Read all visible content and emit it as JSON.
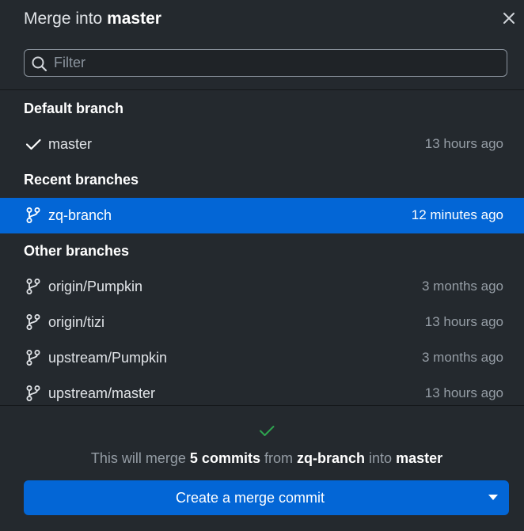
{
  "dialog": {
    "title_prefix": "Merge into",
    "title_target": "master"
  },
  "filter": {
    "placeholder": "Filter",
    "value": ""
  },
  "sections": {
    "default": "Default branch",
    "recent": "Recent branches",
    "other": "Other branches"
  },
  "branches": {
    "default": [
      {
        "name": "master",
        "time": "13 hours ago",
        "icon": "check-icon"
      }
    ],
    "recent": [
      {
        "name": "zq-branch",
        "time": "12 minutes ago",
        "icon": "git-branch-icon",
        "selected": true
      }
    ],
    "other": [
      {
        "name": "origin/Pumpkin",
        "time": "3 months ago",
        "icon": "git-branch-icon"
      },
      {
        "name": "origin/tizi",
        "time": "13 hours ago",
        "icon": "git-branch-icon"
      },
      {
        "name": "upstream/Pumpkin",
        "time": "3 months ago",
        "icon": "git-branch-icon"
      },
      {
        "name": "upstream/master",
        "time": "13 hours ago",
        "icon": "git-branch-icon"
      }
    ]
  },
  "merge_summary": {
    "prefix": "This will merge",
    "commits": "5 commits",
    "from_word": "from",
    "source": "zq-branch",
    "into_word": "into",
    "target": "master"
  },
  "merge_button": {
    "label": "Create a merge commit"
  },
  "colors": {
    "background": "#24292e",
    "accent": "#0366d6",
    "success": "#2ea44f",
    "muted": "#959da5"
  }
}
